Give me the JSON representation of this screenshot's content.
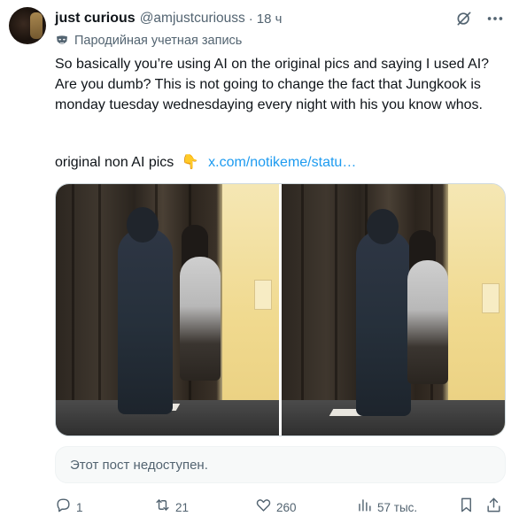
{
  "author": {
    "name": "just curious",
    "handle": "@amjustcuriouss",
    "separator": "·",
    "time": "18 ч",
    "label": "Пародийная учетная запись"
  },
  "post": {
    "text": "So basically you’re using AI on the original pics and saying I used AI? Are you dumb? This is not going to change the fact that Jungkook is monday tuesday wednesdaying every night with his you know whos.",
    "line2_text": "original non AI pics",
    "line2_emoji": "👇",
    "link_text": "x.com/notikeme/statu…"
  },
  "quote": {
    "unavailable_text": "Этот пост недоступен."
  },
  "actions": {
    "replies": "1",
    "reposts": "21",
    "likes": "260",
    "views": "57 тыс."
  },
  "icons": {
    "grok": "grok-icon",
    "more": "more-icon",
    "parody": "parody-mask-icon",
    "reply": "reply-icon",
    "repost": "repost-icon",
    "like": "heart-icon",
    "views": "views-icon",
    "bookmark": "bookmark-icon",
    "share": "share-icon"
  },
  "colors": {
    "text": "#0f1419",
    "secondary": "#536471",
    "link": "#1d9bf0",
    "border": "#cfd9de"
  }
}
